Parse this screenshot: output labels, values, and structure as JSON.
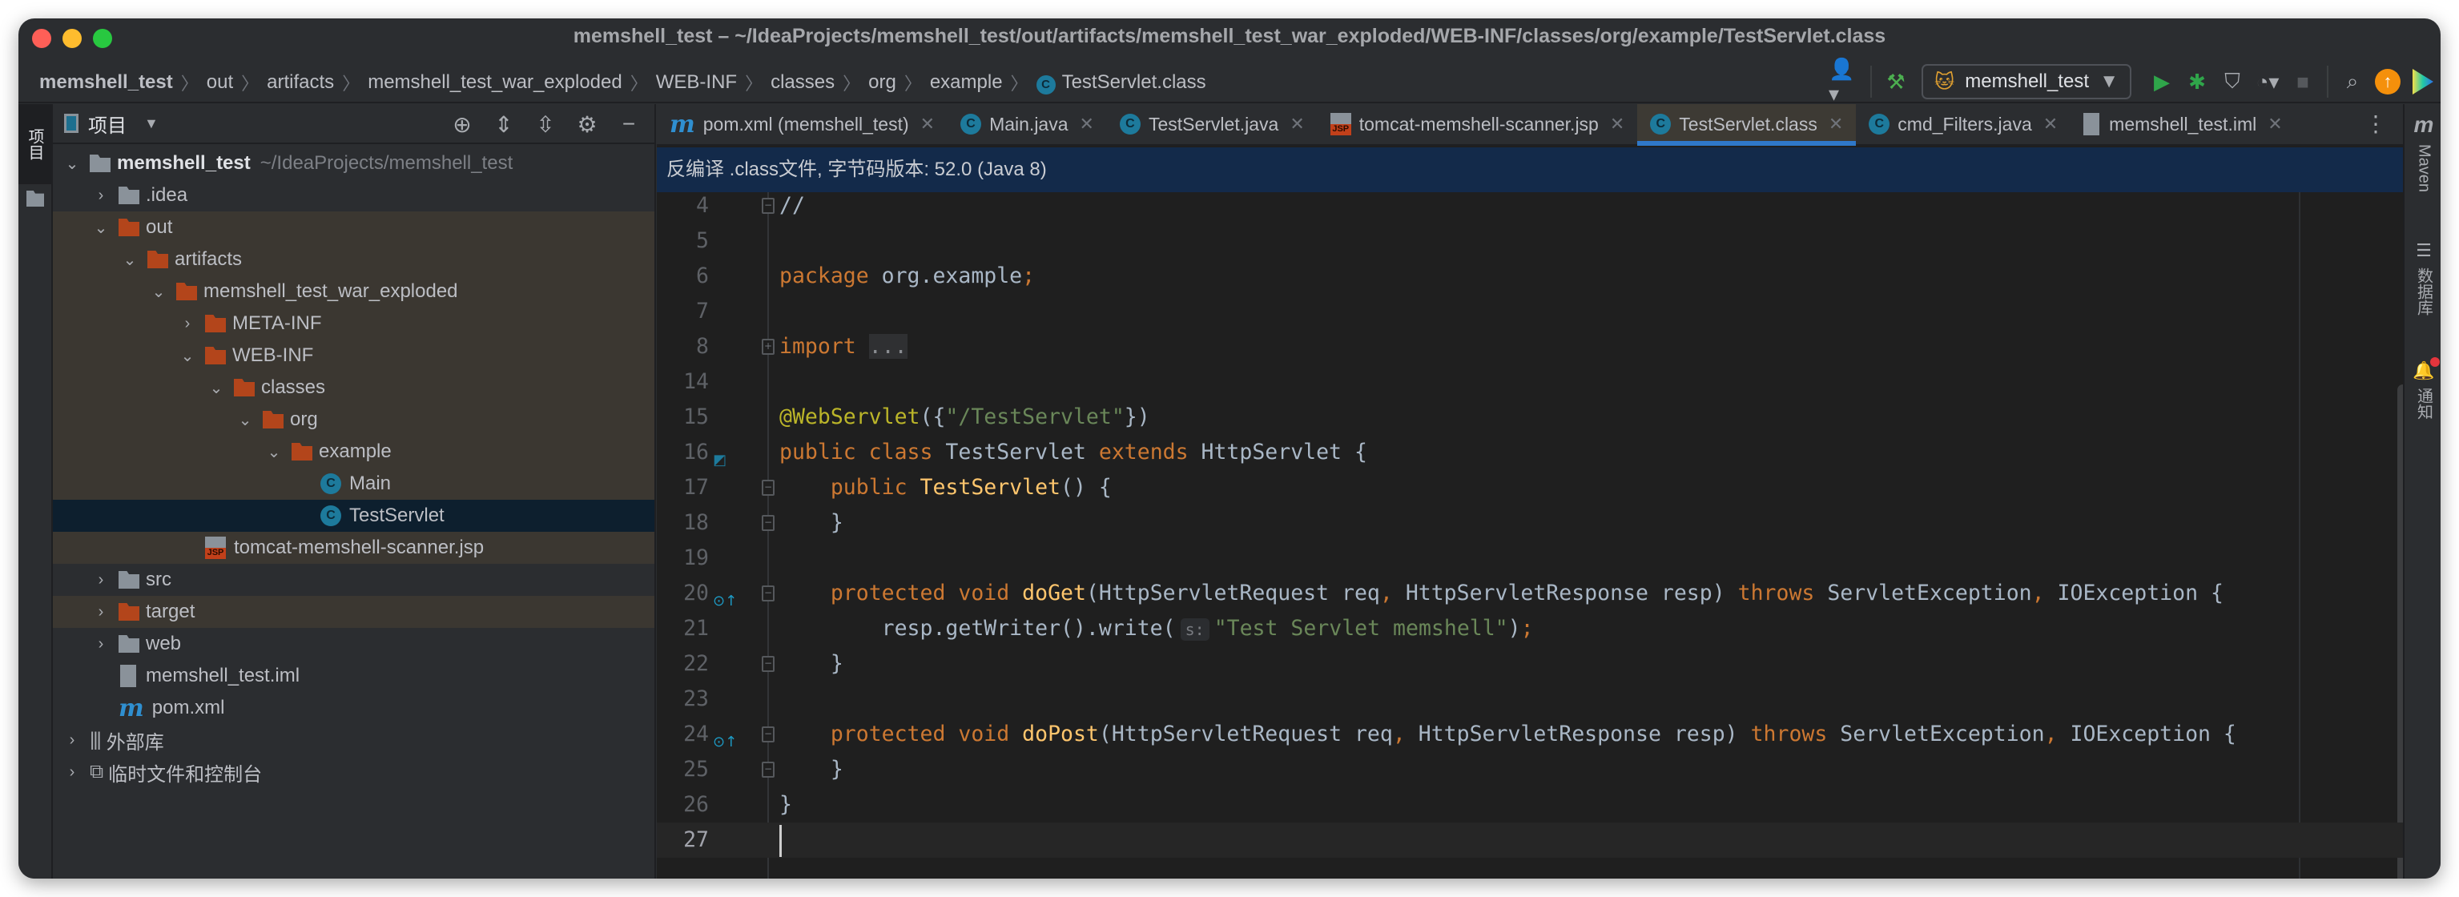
{
  "window": {
    "title": "memshell_test – ~/IdeaProjects/memshell_test/out/artifacts/memshell_test_war_exploded/WEB-INF/classes/org/example/TestServlet.class",
    "traffic_colors": [
      "#fe5f57",
      "#febc2e",
      "#28c840"
    ]
  },
  "breadcrumb": [
    "memshell_test",
    "out",
    "artifacts",
    "memshell_test_war_exploded",
    "WEB-INF",
    "classes",
    "org",
    "example",
    "TestServlet.class"
  ],
  "toolbar": {
    "run_config": "memshell_test",
    "icons": [
      "user-icon",
      "build-hammer-icon",
      "run-icon",
      "debug-icon",
      "coverage-icon",
      "profile-icon",
      "stop-icon",
      "search-icon",
      "update-icon",
      "jetbrains-logo-icon"
    ]
  },
  "left_stripe": {
    "tab_label": "项目"
  },
  "project": {
    "title": "项目",
    "tree": [
      {
        "label": "memshell_test",
        "hint": "~/IdeaProjects/memshell_test",
        "level": 0,
        "expanded": true,
        "icon": "module",
        "bold": true
      },
      {
        "label": ".idea",
        "level": 1,
        "expanded": false,
        "icon": "folder-gray"
      },
      {
        "label": "out",
        "level": 1,
        "expanded": true,
        "icon": "folder",
        "hl": true
      },
      {
        "label": "artifacts",
        "level": 2,
        "expanded": true,
        "icon": "folder",
        "hl": true
      },
      {
        "label": "memshell_test_war_exploded",
        "level": 3,
        "expanded": true,
        "icon": "folder",
        "hl": true
      },
      {
        "label": "META-INF",
        "level": 4,
        "expanded": false,
        "icon": "folder",
        "hl": true
      },
      {
        "label": "WEB-INF",
        "level": 4,
        "expanded": true,
        "icon": "folder",
        "hl": true
      },
      {
        "label": "classes",
        "level": 5,
        "expanded": true,
        "icon": "folder",
        "hl": true
      },
      {
        "label": "org",
        "level": 6,
        "expanded": true,
        "icon": "folder",
        "hl": true
      },
      {
        "label": "example",
        "level": 7,
        "expanded": true,
        "icon": "folder",
        "hl": true
      },
      {
        "label": "Main",
        "level": 8,
        "icon": "class",
        "hl": true
      },
      {
        "label": "TestServlet",
        "level": 8,
        "icon": "class",
        "selected": true
      },
      {
        "label": "tomcat-memshell-scanner.jsp",
        "level": 4,
        "icon": "jsp",
        "hl": true
      },
      {
        "label": "src",
        "level": 1,
        "expanded": false,
        "icon": "folder-gray"
      },
      {
        "label": "target",
        "level": 1,
        "expanded": false,
        "icon": "folder",
        "hl": true
      },
      {
        "label": "web",
        "level": 1,
        "expanded": false,
        "icon": "folder-gray"
      },
      {
        "label": "memshell_test.iml",
        "level": 1,
        "icon": "file"
      },
      {
        "label": "pom.xml",
        "level": 1,
        "icon": "maven"
      },
      {
        "label": "外部库",
        "level": 0,
        "expanded": false,
        "icon": "library"
      },
      {
        "label": "临时文件和控制台",
        "level": 0,
        "expanded": false,
        "icon": "scratch"
      }
    ]
  },
  "tabs": [
    {
      "label": "pom.xml (memshell_test)",
      "icon": "maven"
    },
    {
      "label": "Main.java",
      "icon": "class"
    },
    {
      "label": "TestServlet.java",
      "icon": "class"
    },
    {
      "label": "tomcat-memshell-scanner.jsp",
      "icon": "jsp"
    },
    {
      "label": "TestServlet.class",
      "icon": "class",
      "active": true
    },
    {
      "label": "cmd_Filters.java",
      "icon": "class"
    },
    {
      "label": "memshell_test.iml",
      "icon": "file"
    }
  ],
  "banner": "反编译 .class文件, 字节码版本: 52.0 (Java 8)",
  "code": {
    "current_line": 27,
    "lines": [
      {
        "n": 4,
        "fold": "end",
        "tokens": [
          [
            "//",
            "pl"
          ]
        ]
      },
      {
        "n": 5,
        "tokens": []
      },
      {
        "n": 6,
        "tokens": [
          [
            "package",
            "kw"
          ],
          [
            " org.example",
            "pl"
          ],
          [
            ";",
            "kw"
          ]
        ]
      },
      {
        "n": 7,
        "tokens": []
      },
      {
        "n": 8,
        "fold": "plus",
        "tokens": [
          [
            "import",
            "kw"
          ],
          [
            " ",
            "pl"
          ],
          [
            "...",
            "fl"
          ]
        ]
      },
      {
        "n": 14,
        "tokens": []
      },
      {
        "n": 15,
        "tokens": [
          [
            "@WebServlet",
            "ann"
          ],
          [
            "({",
            "pl"
          ],
          [
            "\"/TestServlet\"",
            "str"
          ],
          [
            "})",
            "pl"
          ]
        ]
      },
      {
        "n": 16,
        "gutter": "servlet",
        "tokens": [
          [
            "public class ",
            "kw"
          ],
          [
            "TestServlet ",
            "pl"
          ],
          [
            "extends ",
            "kw"
          ],
          [
            "HttpServlet {",
            "pl"
          ]
        ]
      },
      {
        "n": 17,
        "fold": "start",
        "tokens": [
          [
            "    ",
            "pl"
          ],
          [
            "public ",
            "kw"
          ],
          [
            "TestServlet",
            "fn"
          ],
          [
            "() {",
            "pl"
          ]
        ]
      },
      {
        "n": 18,
        "fold": "end",
        "tokens": [
          [
            "    }",
            "pl"
          ]
        ]
      },
      {
        "n": 19,
        "tokens": []
      },
      {
        "n": 20,
        "fold": "start",
        "gutter": "override",
        "tokens": [
          [
            "    ",
            "pl"
          ],
          [
            "protected void ",
            "kw"
          ],
          [
            "doGet",
            "fn"
          ],
          [
            "(HttpServletRequest req",
            "pl"
          ],
          [
            ", ",
            "kw"
          ],
          [
            "HttpServletResponse resp) ",
            "pl"
          ],
          [
            "throws ",
            "kw"
          ],
          [
            "ServletException",
            "pl"
          ],
          [
            ", ",
            "kw"
          ],
          [
            "IOException {",
            "pl"
          ]
        ]
      },
      {
        "n": 21,
        "tokens": [
          [
            "        resp.getWriter().write(",
            "pl"
          ],
          [
            "s:",
            "hint"
          ],
          [
            "\"Test Servlet memshell\"",
            "str"
          ],
          [
            ")",
            "pl"
          ],
          [
            ";",
            "kw"
          ]
        ]
      },
      {
        "n": 22,
        "fold": "end",
        "tokens": [
          [
            "    }",
            "pl"
          ]
        ]
      },
      {
        "n": 23,
        "tokens": []
      },
      {
        "n": 24,
        "fold": "start",
        "gutter": "override",
        "tokens": [
          [
            "    ",
            "pl"
          ],
          [
            "protected void ",
            "kw"
          ],
          [
            "doPost",
            "fn"
          ],
          [
            "(HttpServletRequest req",
            "pl"
          ],
          [
            ", ",
            "kw"
          ],
          [
            "HttpServletResponse resp) ",
            "pl"
          ],
          [
            "throws ",
            "kw"
          ],
          [
            "ServletException",
            "pl"
          ],
          [
            ", ",
            "kw"
          ],
          [
            "IOException {",
            "pl"
          ]
        ]
      },
      {
        "n": 25,
        "fold": "end",
        "tokens": [
          [
            "    }",
            "pl"
          ]
        ]
      },
      {
        "n": 26,
        "tokens": [
          [
            "}",
            "pl"
          ]
        ]
      },
      {
        "n": 27,
        "tokens": []
      }
    ]
  },
  "right_stripe": [
    {
      "label": "Maven",
      "icon": "maven-icon"
    },
    {
      "label": "数据库",
      "icon": "database-icon"
    },
    {
      "label": "通知",
      "icon": "bell-icon",
      "badge_color": "#e5353d"
    }
  ]
}
